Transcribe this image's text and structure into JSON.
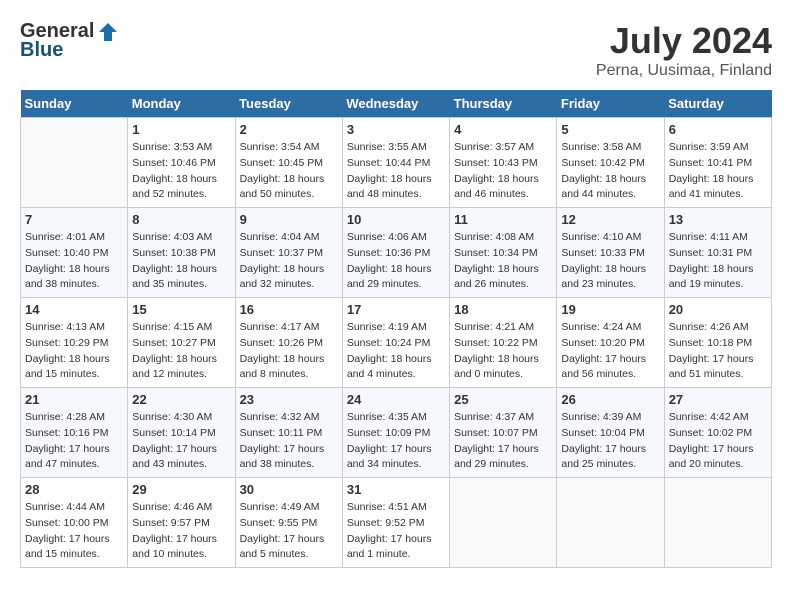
{
  "header": {
    "logo_general": "General",
    "logo_blue": "Blue",
    "month": "July 2024",
    "location": "Perna, Uusimaa, Finland"
  },
  "weekdays": [
    "Sunday",
    "Monday",
    "Tuesday",
    "Wednesday",
    "Thursday",
    "Friday",
    "Saturday"
  ],
  "weeks": [
    [
      {
        "day": "",
        "info": ""
      },
      {
        "day": "1",
        "info": "Sunrise: 3:53 AM\nSunset: 10:46 PM\nDaylight: 18 hours\nand 52 minutes."
      },
      {
        "day": "2",
        "info": "Sunrise: 3:54 AM\nSunset: 10:45 PM\nDaylight: 18 hours\nand 50 minutes."
      },
      {
        "day": "3",
        "info": "Sunrise: 3:55 AM\nSunset: 10:44 PM\nDaylight: 18 hours\nand 48 minutes."
      },
      {
        "day": "4",
        "info": "Sunrise: 3:57 AM\nSunset: 10:43 PM\nDaylight: 18 hours\nand 46 minutes."
      },
      {
        "day": "5",
        "info": "Sunrise: 3:58 AM\nSunset: 10:42 PM\nDaylight: 18 hours\nand 44 minutes."
      },
      {
        "day": "6",
        "info": "Sunrise: 3:59 AM\nSunset: 10:41 PM\nDaylight: 18 hours\nand 41 minutes."
      }
    ],
    [
      {
        "day": "7",
        "info": "Sunrise: 4:01 AM\nSunset: 10:40 PM\nDaylight: 18 hours\nand 38 minutes."
      },
      {
        "day": "8",
        "info": "Sunrise: 4:03 AM\nSunset: 10:38 PM\nDaylight: 18 hours\nand 35 minutes."
      },
      {
        "day": "9",
        "info": "Sunrise: 4:04 AM\nSunset: 10:37 PM\nDaylight: 18 hours\nand 32 minutes."
      },
      {
        "day": "10",
        "info": "Sunrise: 4:06 AM\nSunset: 10:36 PM\nDaylight: 18 hours\nand 29 minutes."
      },
      {
        "day": "11",
        "info": "Sunrise: 4:08 AM\nSunset: 10:34 PM\nDaylight: 18 hours\nand 26 minutes."
      },
      {
        "day": "12",
        "info": "Sunrise: 4:10 AM\nSunset: 10:33 PM\nDaylight: 18 hours\nand 23 minutes."
      },
      {
        "day": "13",
        "info": "Sunrise: 4:11 AM\nSunset: 10:31 PM\nDaylight: 18 hours\nand 19 minutes."
      }
    ],
    [
      {
        "day": "14",
        "info": "Sunrise: 4:13 AM\nSunset: 10:29 PM\nDaylight: 18 hours\nand 15 minutes."
      },
      {
        "day": "15",
        "info": "Sunrise: 4:15 AM\nSunset: 10:27 PM\nDaylight: 18 hours\nand 12 minutes."
      },
      {
        "day": "16",
        "info": "Sunrise: 4:17 AM\nSunset: 10:26 PM\nDaylight: 18 hours\nand 8 minutes."
      },
      {
        "day": "17",
        "info": "Sunrise: 4:19 AM\nSunset: 10:24 PM\nDaylight: 18 hours\nand 4 minutes."
      },
      {
        "day": "18",
        "info": "Sunrise: 4:21 AM\nSunset: 10:22 PM\nDaylight: 18 hours\nand 0 minutes."
      },
      {
        "day": "19",
        "info": "Sunrise: 4:24 AM\nSunset: 10:20 PM\nDaylight: 17 hours\nand 56 minutes."
      },
      {
        "day": "20",
        "info": "Sunrise: 4:26 AM\nSunset: 10:18 PM\nDaylight: 17 hours\nand 51 minutes."
      }
    ],
    [
      {
        "day": "21",
        "info": "Sunrise: 4:28 AM\nSunset: 10:16 PM\nDaylight: 17 hours\nand 47 minutes."
      },
      {
        "day": "22",
        "info": "Sunrise: 4:30 AM\nSunset: 10:14 PM\nDaylight: 17 hours\nand 43 minutes."
      },
      {
        "day": "23",
        "info": "Sunrise: 4:32 AM\nSunset: 10:11 PM\nDaylight: 17 hours\nand 38 minutes."
      },
      {
        "day": "24",
        "info": "Sunrise: 4:35 AM\nSunset: 10:09 PM\nDaylight: 17 hours\nand 34 minutes."
      },
      {
        "day": "25",
        "info": "Sunrise: 4:37 AM\nSunset: 10:07 PM\nDaylight: 17 hours\nand 29 minutes."
      },
      {
        "day": "26",
        "info": "Sunrise: 4:39 AM\nSunset: 10:04 PM\nDaylight: 17 hours\nand 25 minutes."
      },
      {
        "day": "27",
        "info": "Sunrise: 4:42 AM\nSunset: 10:02 PM\nDaylight: 17 hours\nand 20 minutes."
      }
    ],
    [
      {
        "day": "28",
        "info": "Sunrise: 4:44 AM\nSunset: 10:00 PM\nDaylight: 17 hours\nand 15 minutes."
      },
      {
        "day": "29",
        "info": "Sunrise: 4:46 AM\nSunset: 9:57 PM\nDaylight: 17 hours\nand 10 minutes."
      },
      {
        "day": "30",
        "info": "Sunrise: 4:49 AM\nSunset: 9:55 PM\nDaylight: 17 hours\nand 5 minutes."
      },
      {
        "day": "31",
        "info": "Sunrise: 4:51 AM\nSunset: 9:52 PM\nDaylight: 17 hours\nand 1 minute."
      },
      {
        "day": "",
        "info": ""
      },
      {
        "day": "",
        "info": ""
      },
      {
        "day": "",
        "info": ""
      }
    ]
  ]
}
